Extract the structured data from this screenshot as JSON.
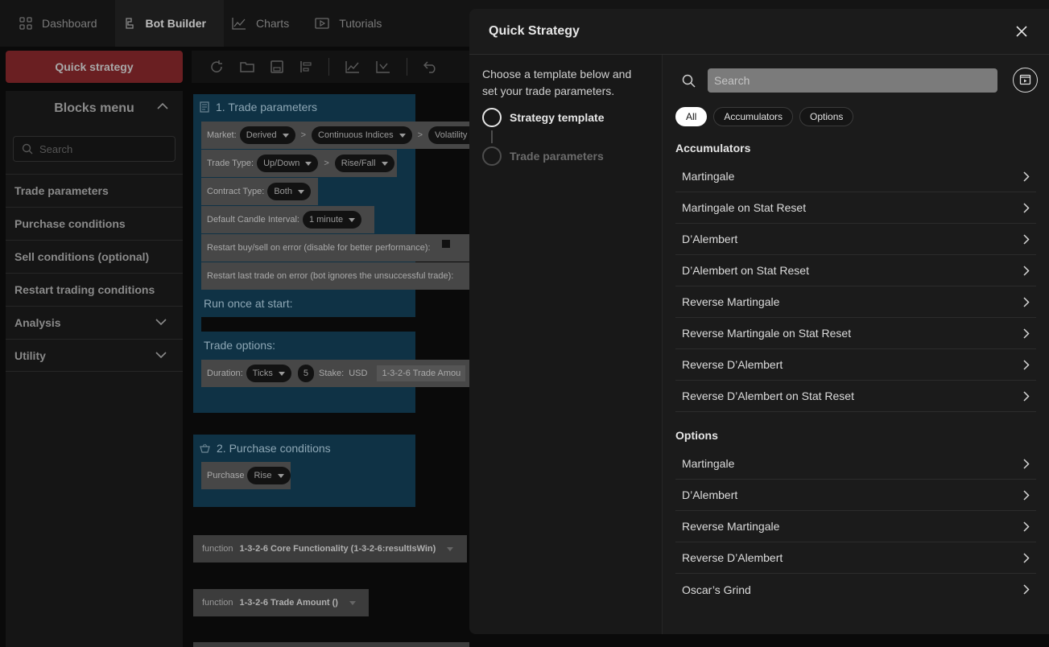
{
  "nav": {
    "tabs": [
      {
        "label": "Dashboard",
        "icon": "dashboard-icon"
      },
      {
        "label": "Bot Builder",
        "icon": "bot-builder-icon"
      },
      {
        "label": "Charts",
        "icon": "charts-icon"
      },
      {
        "label": "Tutorials",
        "icon": "tutorials-icon"
      }
    ],
    "active_tab": "Bot Builder"
  },
  "sidebar": {
    "quick_strategy_label": "Quick strategy",
    "blocks_menu_title": "Blocks menu",
    "search_placeholder": "Search",
    "categories": [
      {
        "label": "Trade parameters"
      },
      {
        "label": "Purchase conditions"
      },
      {
        "label": "Sell conditions (optional)"
      },
      {
        "label": "Restart trading conditions"
      },
      {
        "label": "Analysis"
      },
      {
        "label": "Utility"
      }
    ]
  },
  "workspace": {
    "trade_parameters_block": {
      "title": "1. Trade parameters",
      "market_label": "Market:",
      "market_values": [
        "Derived",
        "Continuous Indices",
        "Volatility"
      ],
      "trade_type_label": "Trade Type:",
      "trade_type_values": [
        "Up/Down",
        "Rise/Fall"
      ],
      "contract_type_label": "Contract Type:",
      "contract_type_value": "Both",
      "candle_interval_label": "Default Candle Interval:",
      "candle_interval_value": "1 minute",
      "restart_buy_sell_label": "Restart buy/sell on error (disable for better performance):",
      "restart_last_trade_label": "Restart last trade on error (bot ignores the unsuccessful trade):",
      "run_once_label": "Run once at start:",
      "trade_options_label": "Trade options:",
      "duration_label": "Duration:",
      "duration_unit": "Ticks",
      "duration_value": "5",
      "stake_label": "Stake:",
      "stake_currency": "USD",
      "stake_value": "1-3-2-6 Trade Amou"
    },
    "purchase_conditions_block": {
      "title": "2. Purchase conditions",
      "purchase_label": "Purchase",
      "purchase_value": "Rise"
    },
    "functions": [
      {
        "keyword": "function",
        "name": "1-3-2-6 Core Functionality (1-3-2-6:resultIsWin)"
      },
      {
        "keyword": "function",
        "name": "1-3-2-6 Trade Amount ()"
      }
    ]
  },
  "modal": {
    "title": "Quick Strategy",
    "intro": "Choose a template below and set your trade parameters.",
    "steps": [
      {
        "label": "Strategy template",
        "active": true
      },
      {
        "label": "Trade parameters",
        "active": false
      }
    ],
    "search_placeholder": "Search",
    "filters": [
      {
        "label": "All",
        "active": true
      },
      {
        "label": "Accumulators",
        "active": false
      },
      {
        "label": "Options",
        "active": false
      }
    ],
    "sections": [
      {
        "title": "Accumulators",
        "items": [
          "Martingale",
          "Martingale on Stat Reset",
          "D’Alembert",
          "D’Alembert on Stat Reset",
          "Reverse Martingale",
          "Reverse Martingale on Stat Reset",
          "Reverse D’Alembert",
          "Reverse D’Alembert on Stat Reset"
        ]
      },
      {
        "title": "Options",
        "items": [
          "Martingale",
          "D’Alembert",
          "Reverse Martingale",
          "Reverse D’Alembert",
          "Oscar’s Grind"
        ]
      }
    ]
  }
}
